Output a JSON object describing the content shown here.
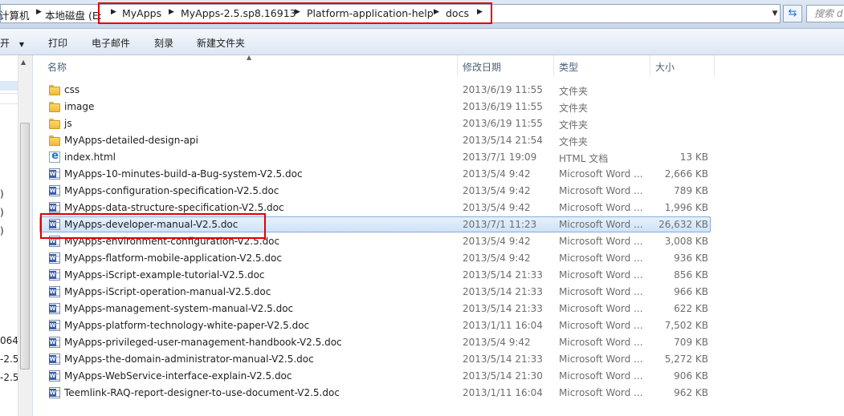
{
  "address": {
    "crumbs": [
      "计算机",
      "本地磁盘 (E:",
      "MyApps",
      "MyApps-2.5.sp8.16913",
      "Platform-application-help",
      "docs"
    ],
    "search_placeholder": "搜索 d"
  },
  "toolbar": {
    "open_label": "开",
    "print_label": "打印",
    "email_label": "电子邮件",
    "burn_label": "刻录",
    "new_folder_label": "新建文件夹"
  },
  "nav": {
    "fragments": [
      ")",
      ")",
      ")",
      "064",
      "-2.5",
      "-2.5"
    ]
  },
  "columns": {
    "name": "名称",
    "date": "修改日期",
    "type": "类型",
    "size": "大小"
  },
  "files": [
    {
      "name": "css",
      "date": "2013/6/19 11:55",
      "type": "文件夹",
      "size": "",
      "icon": "folder-icon"
    },
    {
      "name": "image",
      "date": "2013/6/19 11:55",
      "type": "文件夹",
      "size": "",
      "icon": "folder-icon"
    },
    {
      "name": "js",
      "date": "2013/6/19 11:55",
      "type": "文件夹",
      "size": "",
      "icon": "folder-icon"
    },
    {
      "name": "MyApps-detailed-design-api",
      "date": "2013/5/14 21:54",
      "type": "文件夹",
      "size": "",
      "icon": "folder-icon"
    },
    {
      "name": "index.html",
      "date": "2013/7/1 19:09",
      "type": "HTML 文档",
      "size": "13 KB",
      "icon": "html-icon"
    },
    {
      "name": "MyApps-10-minutes-build-a-Bug-system-V2.5.doc",
      "date": "2013/5/4 9:42",
      "type": "Microsoft Word ...",
      "size": "2,666 KB",
      "icon": "word-icon"
    },
    {
      "name": "MyApps-configuration-specification-V2.5.doc",
      "date": "2013/5/4 9:42",
      "type": "Microsoft Word ...",
      "size": "789 KB",
      "icon": "word-icon"
    },
    {
      "name": "MyApps-data-structure-specification-V2.5.doc",
      "date": "2013/5/4 9:42",
      "type": "Microsoft Word ...",
      "size": "1,996 KB",
      "icon": "word-icon"
    },
    {
      "name": "MyApps-developer-manual-V2.5.doc",
      "date": "2013/7/1 11:23",
      "type": "Microsoft Word ...",
      "size": "26,632 KB",
      "icon": "word-icon",
      "selected": true
    },
    {
      "name": "MyApps-environment-configuration-V2.5.doc",
      "date": "2013/5/4 9:42",
      "type": "Microsoft Word ...",
      "size": "3,008 KB",
      "icon": "word-icon"
    },
    {
      "name": "MyApps-flatform-mobile-application-V2.5.doc",
      "date": "2013/5/4 9:42",
      "type": "Microsoft Word ...",
      "size": "936 KB",
      "icon": "word-icon"
    },
    {
      "name": "MyApps-iScript-example-tutorial-V2.5.doc",
      "date": "2013/5/14 21:33",
      "type": "Microsoft Word ...",
      "size": "856 KB",
      "icon": "word-icon"
    },
    {
      "name": "MyApps-iScript-operation-manual-V2.5.doc",
      "date": "2013/5/14 21:33",
      "type": "Microsoft Word ...",
      "size": "966 KB",
      "icon": "word-icon"
    },
    {
      "name": "MyApps-management-system-manual-V2.5.doc",
      "date": "2013/5/14 21:33",
      "type": "Microsoft Word ...",
      "size": "622 KB",
      "icon": "word-icon"
    },
    {
      "name": "MyApps-platform-technology-white-paper-V2.5.doc",
      "date": "2013/1/11 16:04",
      "type": "Microsoft Word ...",
      "size": "7,502 KB",
      "icon": "word-icon"
    },
    {
      "name": "MyApps-privileged-user-management-handbook-V2.5.doc",
      "date": "2013/5/4 9:42",
      "type": "Microsoft Word ...",
      "size": "709 KB",
      "icon": "word-icon"
    },
    {
      "name": "MyApps-the-domain-administrator-manual-V2.5.doc",
      "date": "2013/5/14 21:33",
      "type": "Microsoft Word ...",
      "size": "5,272 KB",
      "icon": "word-icon"
    },
    {
      "name": "MyApps-WebService-interface-explain-V2.5.doc",
      "date": "2013/5/14 21:30",
      "type": "Microsoft Word ...",
      "size": "906 KB",
      "icon": "word-icon"
    },
    {
      "name": "Teemlink-RAQ-report-designer-to-use-document-V2.5.doc",
      "date": "2013/1/11 16:04",
      "type": "Microsoft Word ...",
      "size": "962 KB",
      "icon": "word-icon"
    }
  ],
  "colors": {
    "highlight_box": "#e00000",
    "selection": "#cfe3f8"
  }
}
